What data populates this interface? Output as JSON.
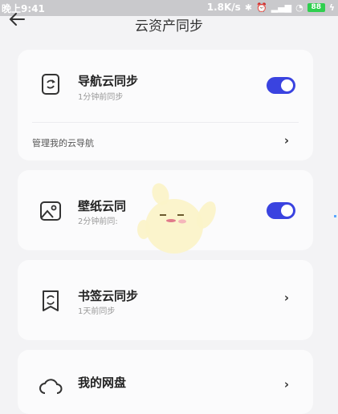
{
  "status_bar": {
    "time": "晚上9:41",
    "net_speed": "1.8K/s",
    "battery": "88"
  },
  "header": {
    "title": "云资产同步"
  },
  "cards": {
    "nav": {
      "title": "导航云同步",
      "subtitle": "1分钟前同步",
      "manage_label": "管理我的云导航",
      "toggle_on": true
    },
    "wallpaper": {
      "title": "壁纸云同",
      "subtitle": "2分钟前同:",
      "toggle_on": true
    },
    "bookmark": {
      "title": "书签云同步",
      "subtitle": "1天前同步"
    },
    "disk": {
      "title": "我的网盘"
    }
  },
  "icons": {
    "back": "arrow-left-icon",
    "nav": "phone-sync-icon",
    "wallpaper": "image-icon",
    "bookmark": "bookmark-sync-icon",
    "disk": "cloud-icon",
    "chevron": "chevron-right-icon"
  },
  "colors": {
    "accent": "#3a43e0",
    "card": "#fbfbfc",
    "background": "#f3f3f5"
  }
}
